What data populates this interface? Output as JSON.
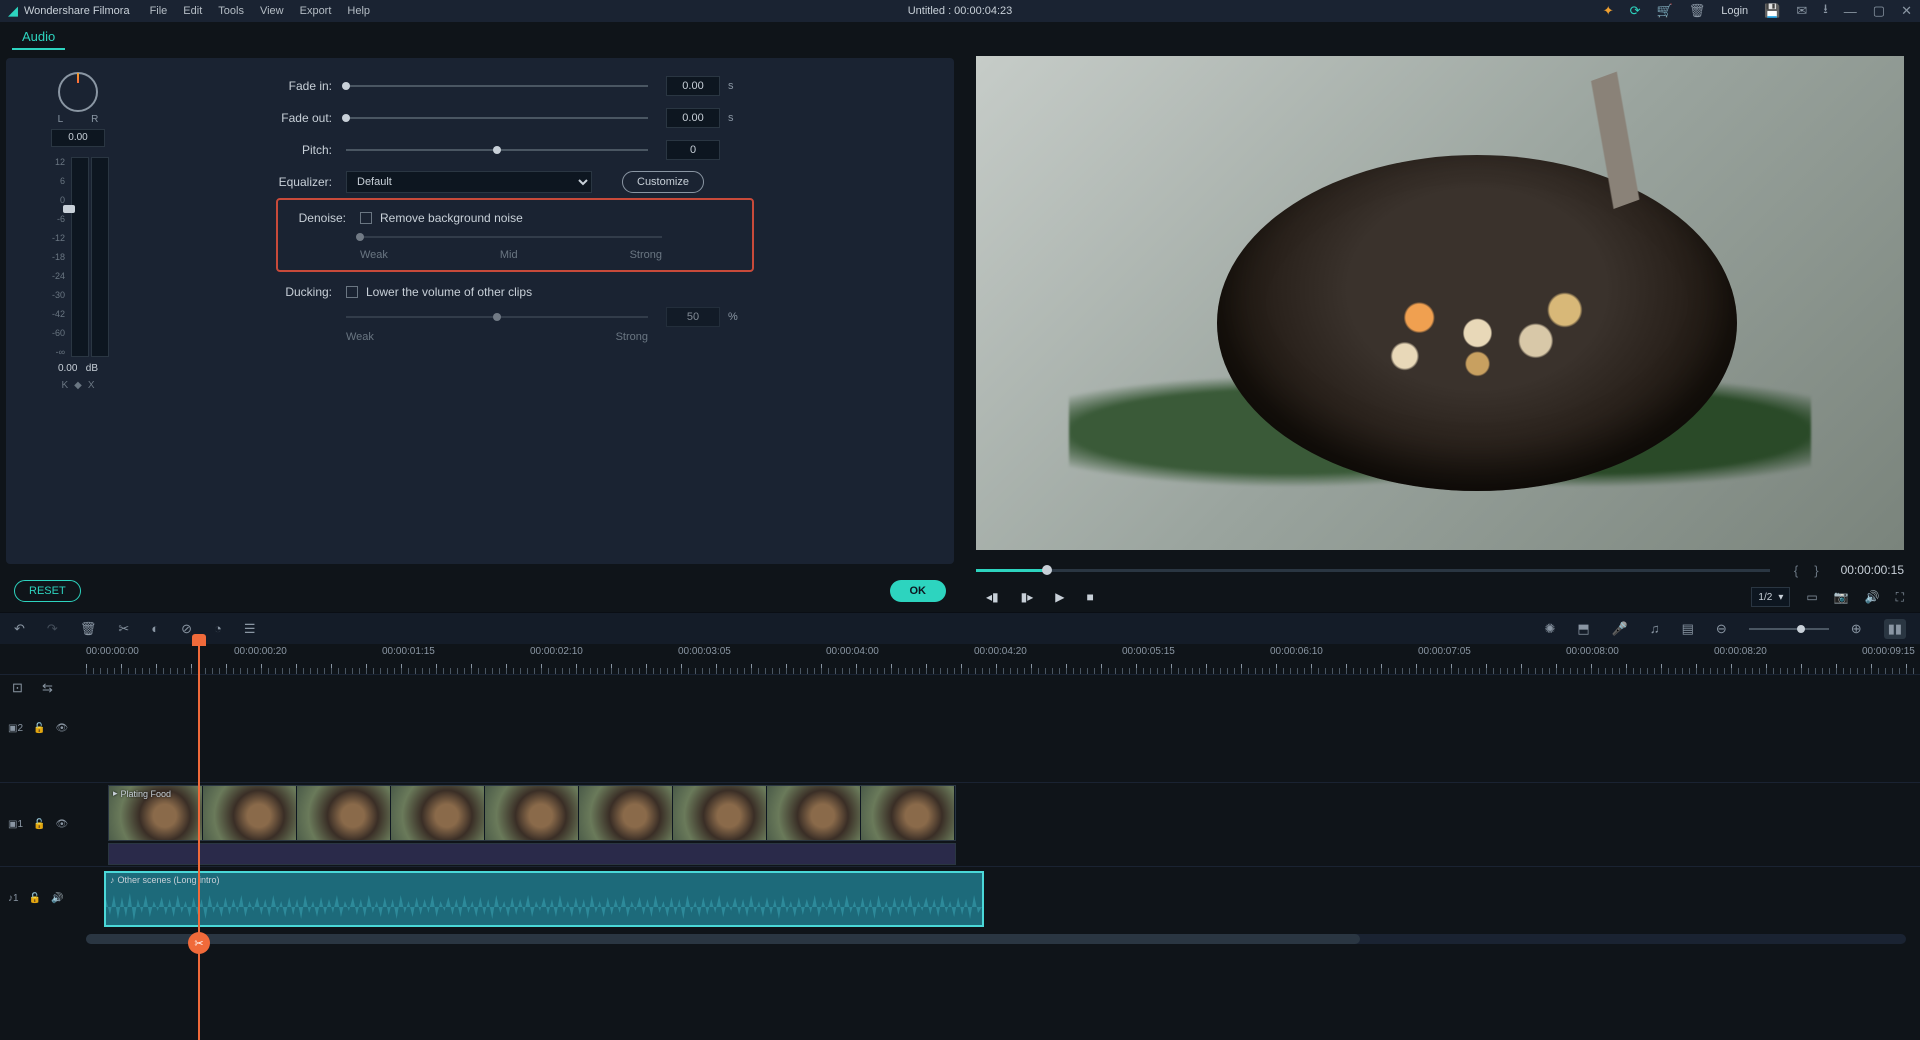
{
  "app": {
    "brand": "Wondershare Filmora",
    "title": "Untitled : 00:00:04:23",
    "login": "Login"
  },
  "menu": [
    "File",
    "Edit",
    "Tools",
    "View",
    "Export",
    "Help"
  ],
  "tabs": {
    "active": "Audio"
  },
  "audio": {
    "balance": {
      "value": "0.00",
      "left": "L",
      "right": "R"
    },
    "meter": {
      "scale": [
        "12",
        "6",
        "0",
        "-6",
        "-12",
        "-18",
        "-24",
        "-30",
        "-42",
        "-60",
        "-∞"
      ],
      "value": "0.00",
      "unit": "dB"
    },
    "fade_in": {
      "label": "Fade in:",
      "value": "0.00",
      "unit": "s",
      "pct": 0
    },
    "fade_out": {
      "label": "Fade out:",
      "value": "0.00",
      "unit": "s",
      "pct": 0
    },
    "pitch": {
      "label": "Pitch:",
      "value": "0",
      "pct": 50
    },
    "equalizer": {
      "label": "Equalizer:",
      "value": "Default",
      "customize": "Customize"
    },
    "denoise": {
      "label": "Denoise:",
      "checkbox": "Remove background noise",
      "sub": [
        "Weak",
        "Mid",
        "Strong"
      ],
      "pct": 0
    },
    "ducking": {
      "label": "Ducking:",
      "checkbox": "Lower the volume of other clips",
      "value": "50",
      "unit": "%",
      "sub": [
        "Weak",
        "Strong"
      ],
      "pct": 50
    },
    "reset": "RESET",
    "ok": "OK"
  },
  "preview": {
    "timecode": "00:00:00:15",
    "progress_pct": 9,
    "zoom": "1/2"
  },
  "ruler_labels": [
    "00:00:00:00",
    "00:00:00:20",
    "00:00:01:15",
    "00:00:02:10",
    "00:00:03:05",
    "00:00:04:00",
    "00:00:04:20",
    "00:00:05:15",
    "00:00:06:10",
    "00:00:07:05",
    "00:00:08:00",
    "00:00:08:20",
    "00:00:09:15"
  ],
  "tracks": {
    "video2": "▣2",
    "video1": "▣1",
    "audio1": "♪1",
    "video_clip": "Plating Food",
    "audio_clip": "Other scenes (Long intro)"
  },
  "keyframe": {
    "prev": "K",
    "diamond": "◆",
    "next": "X"
  }
}
